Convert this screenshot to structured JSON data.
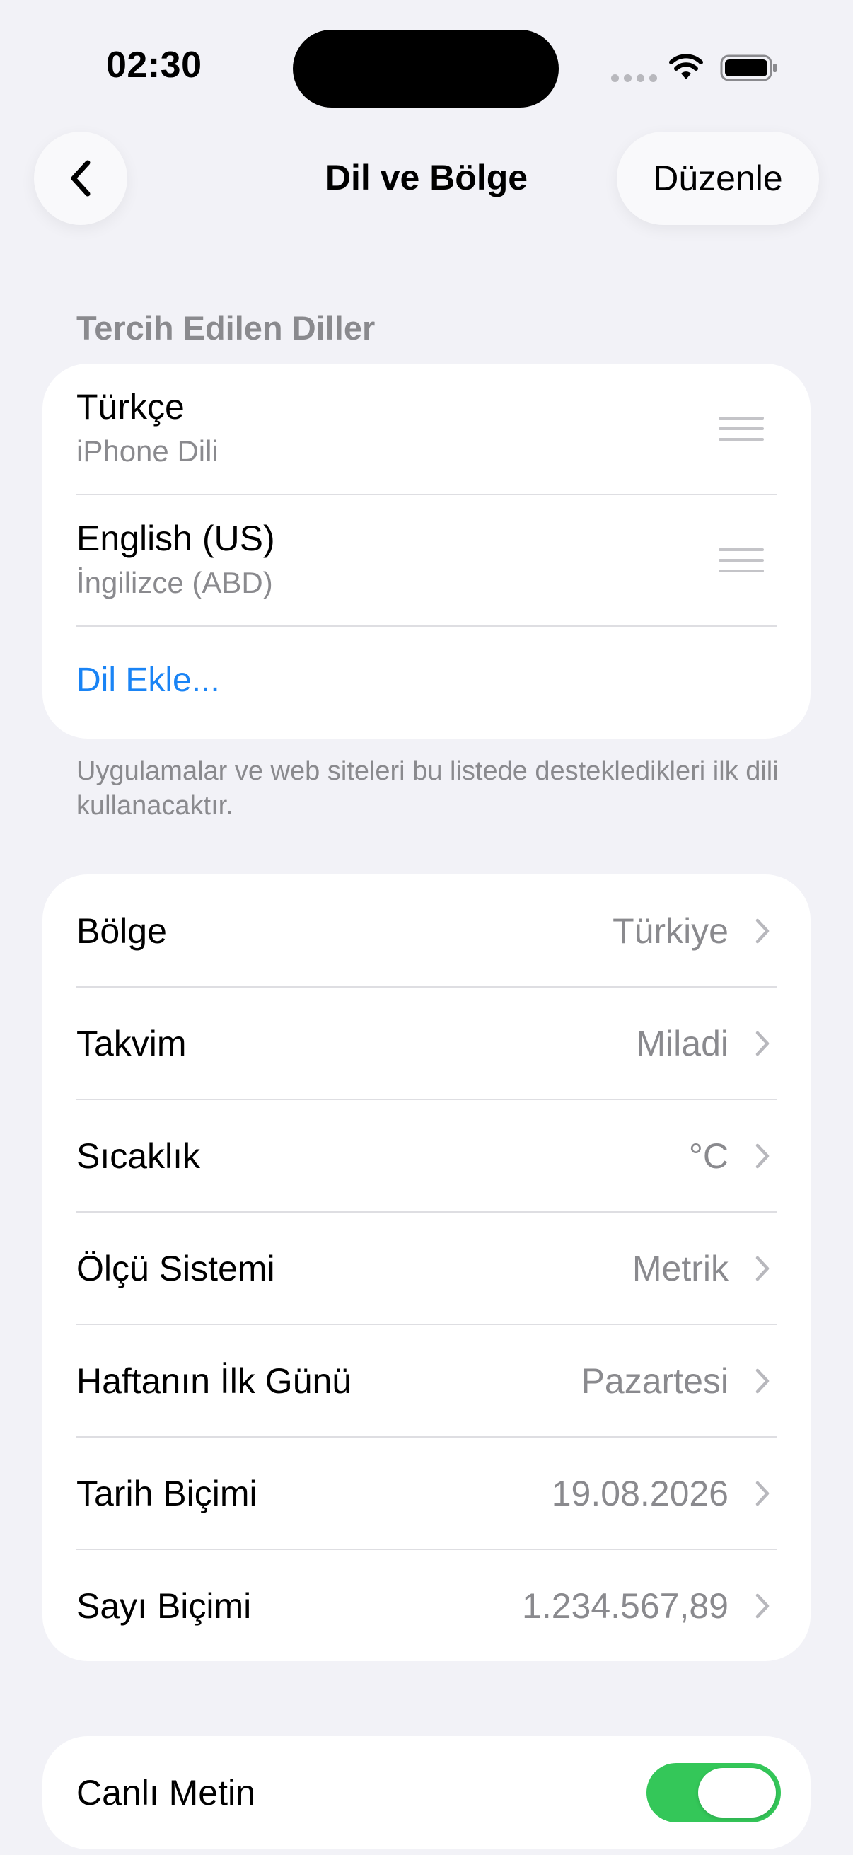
{
  "status_bar": {
    "time": "02:30"
  },
  "nav": {
    "title": "Dil ve Bölge",
    "edit_label": "Düzenle"
  },
  "preferred_languages": {
    "header": "Tercih Edilen Diller",
    "items": [
      {
        "name": "Türkçe",
        "subtitle": "iPhone Dili"
      },
      {
        "name": "English (US)",
        "subtitle": "İngilizce (ABD)"
      }
    ],
    "add_label": "Dil Ekle...",
    "footer": "Uygulamalar ve web siteleri bu listede destekledikleri ilk dili kullanacaktır."
  },
  "settings": [
    {
      "label": "Bölge",
      "value": "Türkiye"
    },
    {
      "label": "Takvim",
      "value": "Miladi"
    },
    {
      "label": "Sıcaklık",
      "value": "°C"
    },
    {
      "label": "Ölçü Sistemi",
      "value": "Metrik"
    },
    {
      "label": "Haftanın İlk Günü",
      "value": "Pazartesi"
    },
    {
      "label": "Tarih Biçimi",
      "value": "19.08.2026"
    },
    {
      "label": "Sayı Biçimi",
      "value": "1.234.567,89"
    }
  ],
  "live_text": {
    "label": "Canlı Metin",
    "enabled": true
  },
  "colors": {
    "accent": "#1a84f5",
    "toggle_on": "#34c759",
    "background": "#f2f2f7",
    "secondary_text": "#8a8a8e"
  },
  "icons": {
    "back": "chevron-left-icon",
    "row": "chevron-right-icon",
    "drag": "drag-handle-icon",
    "wifi": "wifi-icon",
    "battery": "battery-icon",
    "signal": "cellular-signal-icon"
  }
}
